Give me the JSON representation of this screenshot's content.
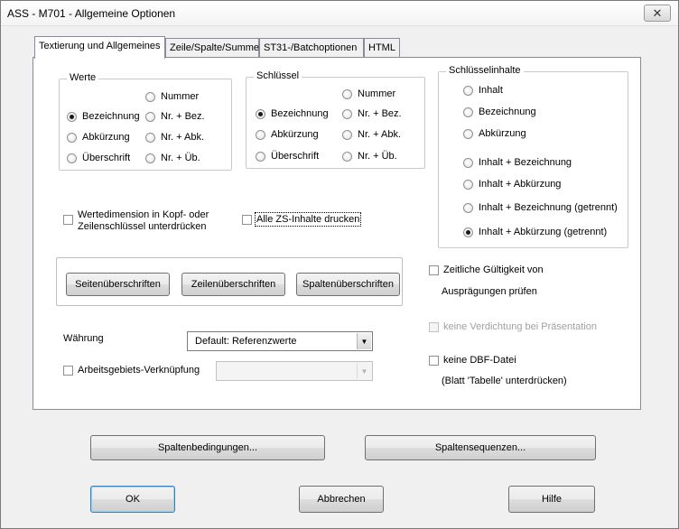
{
  "window": {
    "title": "ASS - M701 - Allgemeine Optionen",
    "close_glyph": "✕"
  },
  "tabs": [
    {
      "label": "Textierung und Allgemeines",
      "active": true
    },
    {
      "label": "Zeile/Spalte/Summe",
      "active": false
    },
    {
      "label": "ST31-/Batchoptionen",
      "active": false
    },
    {
      "label": "HTML",
      "active": false
    }
  ],
  "werte": {
    "legend": "Werte",
    "options": [
      {
        "label": "Nummer",
        "checked": false
      },
      {
        "label": "Bezeichnung",
        "checked": true
      },
      {
        "label": "Nr. + Bez.",
        "checked": false
      },
      {
        "label": "Abkürzung",
        "checked": false
      },
      {
        "label": "Nr. + Abk.",
        "checked": false
      },
      {
        "label": "Überschrift",
        "checked": false
      },
      {
        "label": "Nr. + Üb.",
        "checked": false
      }
    ]
  },
  "schluessel": {
    "legend": "Schlüssel",
    "options": [
      {
        "label": "Nummer",
        "checked": false
      },
      {
        "label": "Bezeichnung",
        "checked": true
      },
      {
        "label": "Nr. + Bez.",
        "checked": false
      },
      {
        "label": "Abkürzung",
        "checked": false
      },
      {
        "label": "Nr. + Abk.",
        "checked": false
      },
      {
        "label": "Überschrift",
        "checked": false
      },
      {
        "label": "Nr. + Üb.",
        "checked": false
      }
    ]
  },
  "schluesselinhalte": {
    "legend": "Schlüsselinhalte",
    "options": [
      {
        "label": "Inhalt",
        "checked": false
      },
      {
        "label": "Bezeichnung",
        "checked": false
      },
      {
        "label": "Abkürzung",
        "checked": false
      },
      {
        "label": "Inhalt + Bezeichnung",
        "checked": false
      },
      {
        "label": "Inhalt + Abkürzung",
        "checked": false
      },
      {
        "label": "Inhalt + Bezeichnung (getrennt)",
        "checked": false
      },
      {
        "label": "Inhalt + Abkürzung (getrennt)",
        "checked": true
      }
    ]
  },
  "checkboxes": {
    "wertedimension_line1": "Wertedimension in Kopf- oder",
    "wertedimension_line2": "Zeilenschlüssel unterdrücken",
    "alle_zs": "Alle ZS-Inhalte drucken",
    "zeitliche_line1": "Zeitliche Gültigkeit von",
    "zeitliche_line2": "Ausprägungen prüfen",
    "keine_verdichtung": "keine Verdichtung bei Präsentation",
    "keine_dbf_line1": "keine DBF-Datei",
    "keine_dbf_line2": "(Blatt 'Tabelle' unterdrücken)",
    "arbeitsgebiets": "Arbeitsgebiets-Verknüpfung"
  },
  "header_buttons": {
    "seiten": "Seitenüberschriften",
    "zeilen": "Zeilenüberschriften",
    "spalten": "Spaltenüberschriften"
  },
  "waehrung": {
    "label": "Währung",
    "selected": "Default: Referenzwerte",
    "arrow": "▼"
  },
  "arbeitsgebiet_select": {
    "selected": "",
    "arrow": "▼"
  },
  "bottom_buttons": {
    "spaltenbedingungen": "Spaltenbedingungen...",
    "spaltensequenzen": "Spaltensequenzen...",
    "ok": "OK",
    "abbrechen": "Abbrechen",
    "hilfe": "Hilfe"
  }
}
